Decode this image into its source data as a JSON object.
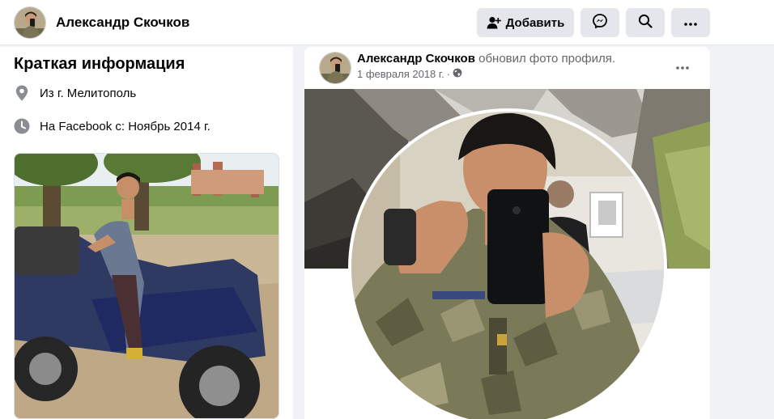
{
  "header": {
    "profile_name": "Александр Скочков",
    "add_friend_label": "Добавить",
    "icons": {
      "add_friend": "person-plus-icon",
      "messenger": "messenger-icon",
      "search": "search-icon",
      "more": "more-icon"
    }
  },
  "intro": {
    "title": "Краткая информация",
    "hometown": "Из г. Мелитополь",
    "joined": "На Facebook с: Ноябрь 2014 г.",
    "icons": {
      "hometown": "location-pin-icon",
      "joined": "clock-icon"
    }
  },
  "post": {
    "author": "Александр Скочков",
    "action": "обновил фото профиля.",
    "date": "1 февраля 2018 г.",
    "dot": "·",
    "privacy_icon": "globe-icon",
    "more_icon": "more-icon"
  },
  "colors": {
    "background": "#f0f2f5",
    "card": "#ffffff",
    "button": "#e4e6eb",
    "secondary_text": "#65676b",
    "primary_text": "#050505"
  }
}
